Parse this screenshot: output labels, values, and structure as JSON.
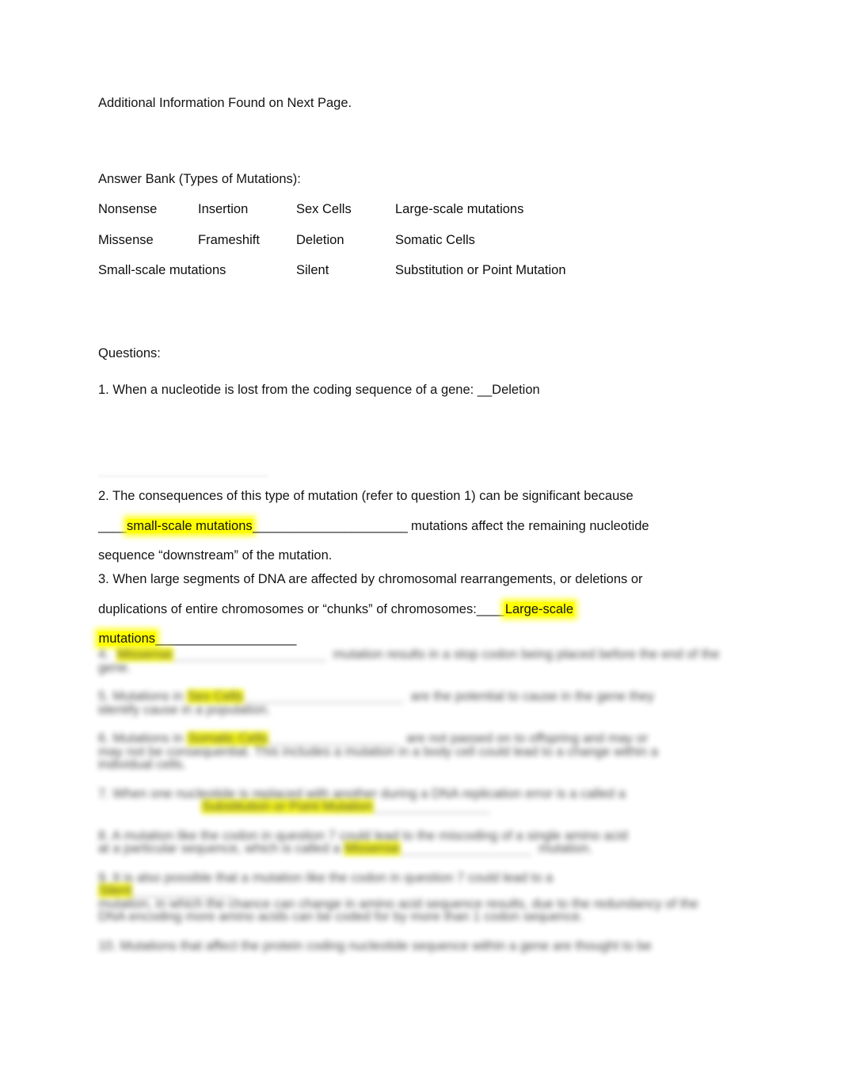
{
  "document": {
    "header_note": "Additional Information Found on Next Page.",
    "answer_bank": {
      "title": "Answer Bank (Types of Mutations):",
      "rows": [
        [
          "Nonsense",
          "Insertion",
          "Sex Cells",
          "Large-scale mutations"
        ],
        [
          "Missense",
          "Frameshift",
          "Deletion",
          "Somatic Cells"
        ],
        [
          "Small-scale mutations",
          "",
          "Silent",
          "Substitution or Point Mutation"
        ]
      ]
    },
    "questions_heading": "Questions:",
    "questions": [
      {
        "number": "1.",
        "text_before": "When a nucleotide is lost from the coding sequence of a gene: __Deletion",
        "answer": "",
        "highlighted": false
      }
    ],
    "q2": {
      "line1": "2. The consequences of this type of mutation (refer to question 1) can be significant because",
      "blank_lead": "____",
      "answer": "small-scale mutations",
      "blank_trail": "______________________",
      "line2_tail": " mutations affect the remaining nucleotide",
      "line3": "sequence “downstream” of the mutation."
    },
    "q3": {
      "line1": "3. When large segments of DNA are affected by chromosomal rearrangements, or deletions or",
      "line2_lead": "duplications of entire chromosomes or “chunks” of chromosomes:",
      "blank_lead": "____",
      "answer_part1": "Large-scale",
      "answer_part2": "mutations",
      "blank_trail": "____________________"
    },
    "redacted": {
      "note": "Lower portion of page is blurred and illegible.",
      "lines": [
        {
          "lead": "4.  ",
          "hl": "Missense",
          "mid": "_____________________  ",
          "tail": "mutation results in a stop codon being placed before the end of the gene."
        },
        {
          "lead": "5. Mutations in ",
          "hl": "Sex Cells",
          "mid": "______________________  ",
          "tail": "are the potential to cause in the gene they",
          "tail2": "identify cause in a population."
        },
        {
          "lead": "6. Mutations in ",
          "hl": "Somatic Cells",
          "mid": "__________________  ",
          "tail": "are not passed on to offspring and may or",
          "tail2": "may not be consequential. This includes a mutation in a body cell could lead to a change within a",
          "tail3": "individual cells."
        },
        {
          "lead": "7. When one nucleotide is replaced with another during a DNA replication error is a called a",
          "hl": "Substitution or Point Mutation",
          "mid": "________________"
        },
        {
          "lead": "8. A mutation like the codon in question 7 could lead to the miscoding of a single amino acid",
          "tail": "at a particular sequence, which is called a ",
          "hl": "Missense",
          "mid": "__________________  ",
          "tail2": "mutation."
        },
        {
          "lead": "9. It is also possible that a mutation like the codon in question 7 could lead to a",
          "hl": "Silent",
          "mid": "______________",
          "tail": "mutation, in which the chance can change in amino acid sequence results, due to the redundancy of the",
          "tail2": "DNA encoding more amino acids can be coded for by more than 1 codon sequence."
        },
        {
          "lead": "10. Mutations that affect the protein coding nucleotide sequence within a gene are thought to be"
        }
      ]
    }
  }
}
